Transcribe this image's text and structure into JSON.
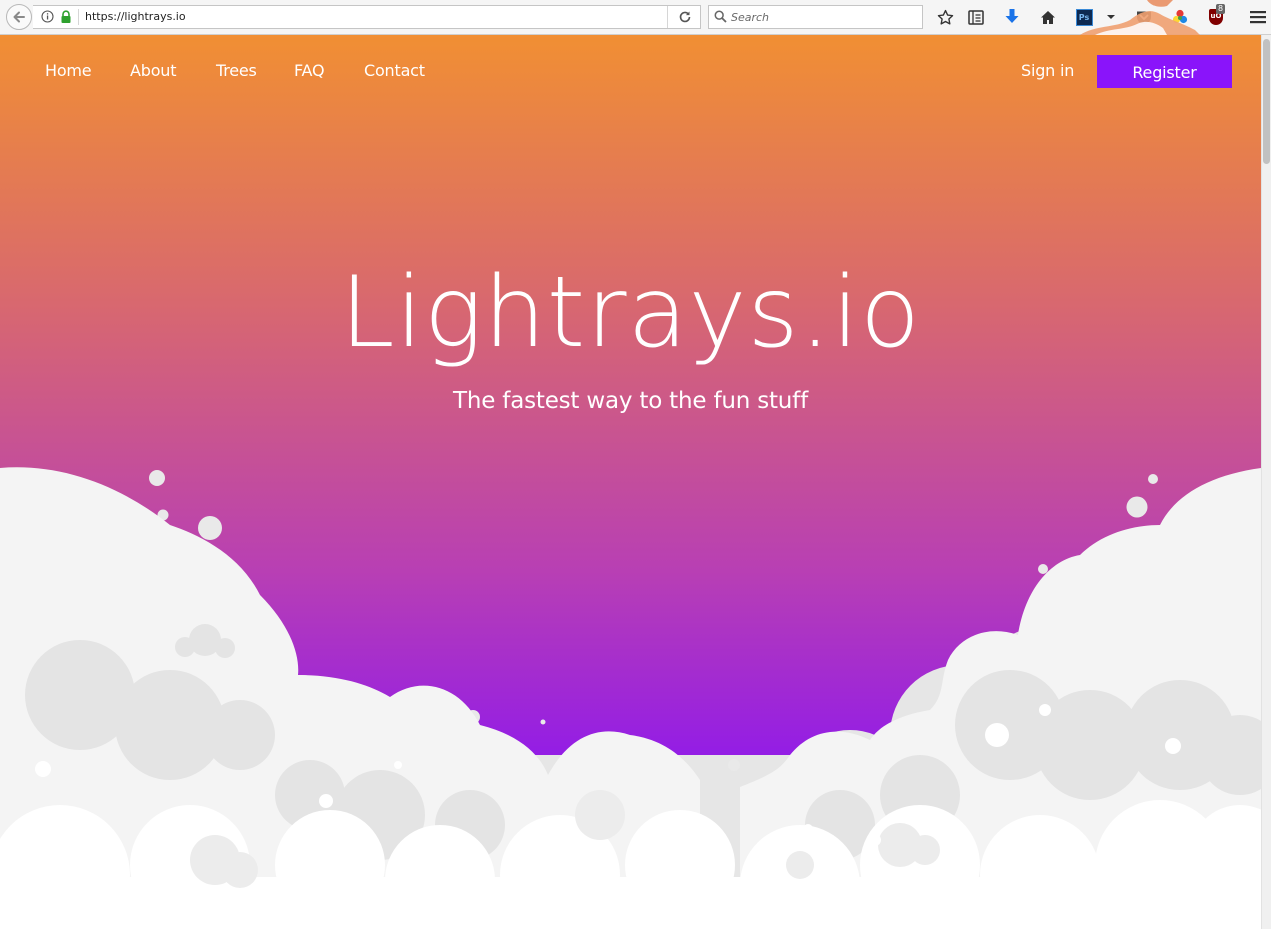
{
  "browser": {
    "url": "https://lightrays.io",
    "search_placeholder": "Search",
    "addon_badge": "8",
    "ps_label": "Ps",
    "ub_label": "uO"
  },
  "nav": {
    "links": [
      "Home",
      "About",
      "Trees",
      "FAQ",
      "Contact"
    ],
    "sign_in": "Sign in",
    "register": "Register"
  },
  "hero": {
    "title": "Lightrays.io",
    "subtitle": "The fastest way to the fun stuff"
  },
  "colors": {
    "gradient_top": "#f18f33",
    "gradient_bottom": "#7b0dfa",
    "register_button": "#8a14fa",
    "cloud_light": "#f4f4f4",
    "cloud_mid": "#e6e6e6"
  },
  "icons": [
    "back-arrow-icon",
    "info-icon",
    "lock-icon",
    "reload-icon",
    "search-icon",
    "star-icon",
    "reading-list-icon",
    "download-icon",
    "home-icon",
    "pocket-icon",
    "colors-icon",
    "menu-icon"
  ]
}
